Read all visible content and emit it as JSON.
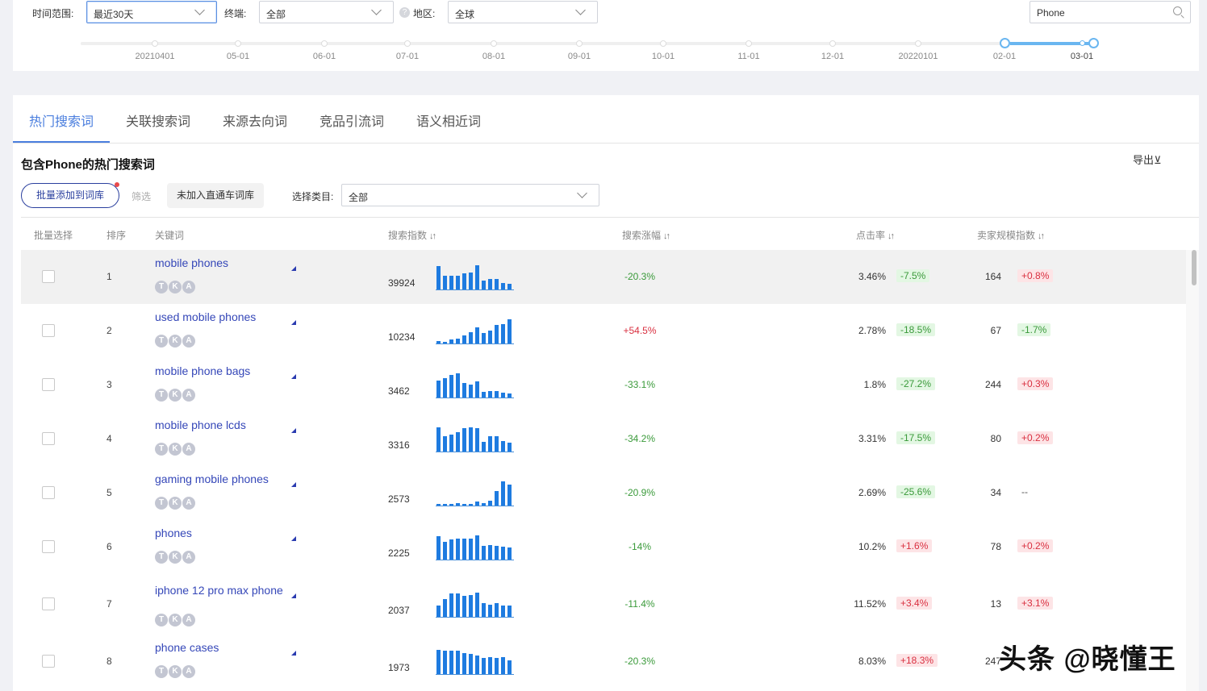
{
  "filters": {
    "time_range_label": "时间范围:",
    "time_range_value": "最近30天",
    "terminal_label": "终端:",
    "terminal_value": "全部",
    "region_label": "地区:",
    "region_value": "全球",
    "help_icon": "?",
    "search_value": "Phone"
  },
  "timeline": {
    "labels": [
      "20210401",
      "05-01",
      "06-01",
      "07-01",
      "08-01",
      "09-01",
      "10-01",
      "11-01",
      "12-01",
      "20220101",
      "02-01",
      "03-01"
    ],
    "selected_start": "02-01",
    "selected_end": "03-01"
  },
  "tabs": [
    {
      "label": "热门搜索词",
      "active": true
    },
    {
      "label": "关联搜索词",
      "active": false
    },
    {
      "label": "来源去向词",
      "active": false
    },
    {
      "label": "竞品引流词",
      "active": false
    },
    {
      "label": "语义相近词",
      "active": false
    }
  ],
  "section": {
    "title": "包含Phone的热门搜索词",
    "export_label": "导出⊻",
    "batch_add_label": "批量添加到词库",
    "filter_label": "筛选",
    "not_added_chip": "未加入直通车词库",
    "category_label": "选择类目:",
    "category_value": "全部"
  },
  "table": {
    "headers": {
      "select": "批量选择",
      "rank": "排序",
      "keyword": "关键词",
      "search_index": "搜索指数",
      "search_growth": "搜索涨幅",
      "ctr": "点击率",
      "seller_index": "卖家规模指数",
      "sort_icon": "↓↑"
    },
    "badges": [
      "T",
      "K",
      "A"
    ],
    "rows": [
      {
        "rank": "1",
        "keyword": "mobile phones",
        "search_index": "39924",
        "trend": [
          0.95,
          0.55,
          0.58,
          0.58,
          0.68,
          0.7,
          1.0,
          0.36,
          0.42,
          0.42,
          0.28,
          0.24
        ],
        "growth": "-20.3%",
        "growth_dir": "neg",
        "ctr": "3.46%",
        "ctr_change": "-7.5%",
        "ctr_dir": "neg",
        "seller": "164",
        "seller_change": "+0.8%",
        "seller_dir": "pos"
      },
      {
        "rank": "2",
        "keyword": "used mobile phones",
        "search_index": "10234",
        "trend": [
          0.1,
          0.07,
          0.18,
          0.2,
          0.32,
          0.48,
          0.68,
          0.42,
          0.52,
          0.76,
          0.8,
          1.0
        ],
        "growth": "+54.5%",
        "growth_dir": "pos",
        "ctr": "2.78%",
        "ctr_change": "-18.5%",
        "ctr_dir": "neg",
        "seller": "67",
        "seller_change": "-1.7%",
        "seller_dir": "neg"
      },
      {
        "rank": "3",
        "keyword": "mobile phone bags",
        "search_index": "3462",
        "trend": [
          0.7,
          0.8,
          0.93,
          1.0,
          0.6,
          0.52,
          0.65,
          0.24,
          0.26,
          0.26,
          0.2,
          0.15
        ],
        "growth": "-33.1%",
        "growth_dir": "neg",
        "ctr": "1.8%",
        "ctr_change": "-27.2%",
        "ctr_dir": "neg",
        "seller": "244",
        "seller_change": "+0.3%",
        "seller_dir": "pos"
      },
      {
        "rank": "4",
        "keyword": "mobile phone lcds",
        "search_index": "3316",
        "trend": [
          1.0,
          0.62,
          0.7,
          0.8,
          0.97,
          1.0,
          0.97,
          0.4,
          0.63,
          0.63,
          0.43,
          0.37
        ],
        "growth": "-34.2%",
        "growth_dir": "neg",
        "ctr": "3.31%",
        "ctr_change": "-17.5%",
        "ctr_dir": "neg",
        "seller": "80",
        "seller_change": "+0.2%",
        "seller_dir": "pos"
      },
      {
        "rank": "5",
        "keyword": "gaming mobile phones",
        "search_index": "2573",
        "trend": [
          0.08,
          0.07,
          0.07,
          0.1,
          0.05,
          0.05,
          0.17,
          0.1,
          0.2,
          0.6,
          1.0,
          0.85
        ],
        "growth": "-20.9%",
        "growth_dir": "neg",
        "ctr": "2.69%",
        "ctr_change": "-25.6%",
        "ctr_dir": "neg",
        "seller": "34",
        "seller_change": "--",
        "seller_dir": "none"
      },
      {
        "rank": "6",
        "keyword": "phones",
        "search_index": "2225",
        "trend": [
          0.95,
          0.72,
          0.82,
          0.88,
          0.86,
          0.86,
          1.0,
          0.55,
          0.6,
          0.56,
          0.52,
          0.49
        ],
        "growth": "-14%",
        "growth_dir": "neg",
        "ctr": "10.2%",
        "ctr_change": "+1.6%",
        "ctr_dir": "pos",
        "seller": "78",
        "seller_change": "+0.2%",
        "seller_dir": "pos"
      },
      {
        "rank": "7",
        "keyword": "iphone 12 pro max phone",
        "search_index": "2037",
        "trend": [
          0.48,
          0.72,
          0.95,
          0.95,
          0.88,
          0.9,
          1.0,
          0.55,
          0.5,
          0.55,
          0.47,
          0.45
        ],
        "growth": "-11.4%",
        "growth_dir": "neg",
        "ctr": "11.52%",
        "ctr_change": "+3.4%",
        "ctr_dir": "pos",
        "seller": "13",
        "seller_change": "+3.1%",
        "seller_dir": "pos"
      },
      {
        "rank": "8",
        "keyword": "phone cases",
        "search_index": "1973",
        "trend": [
          1.0,
          0.98,
          0.98,
          0.98,
          0.88,
          0.82,
          0.75,
          0.65,
          0.7,
          0.67,
          0.7,
          0.58
        ],
        "growth": "-20.3%",
        "growth_dir": "neg",
        "ctr": "8.03%",
        "ctr_change": "+18.3%",
        "ctr_dir": "pos",
        "seller": "247",
        "seller_change": "",
        "seller_dir": "neg"
      }
    ]
  },
  "watermark": "头条 @晓懂王"
}
